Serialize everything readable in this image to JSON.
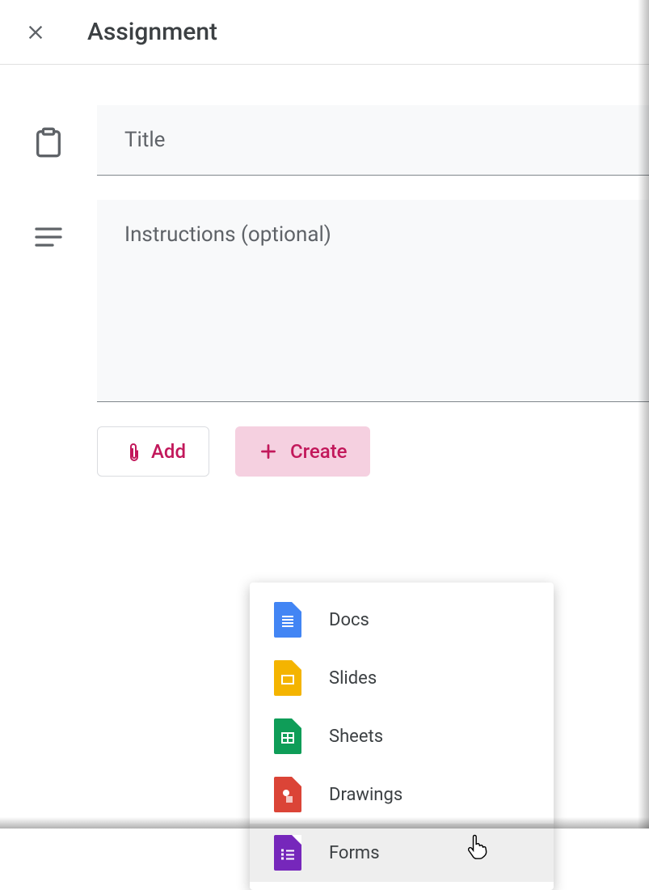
{
  "header": {
    "title": "Assignment"
  },
  "fields": {
    "title_placeholder": "Title",
    "instructions_placeholder": "Instructions (optional)"
  },
  "buttons": {
    "add_label": "Add",
    "create_label": "Create"
  },
  "create_menu": {
    "items": [
      {
        "label": "Docs",
        "icon": "docs"
      },
      {
        "label": "Slides",
        "icon": "slides"
      },
      {
        "label": "Sheets",
        "icon": "sheets"
      },
      {
        "label": "Drawings",
        "icon": "drawings"
      },
      {
        "label": "Forms",
        "icon": "forms"
      }
    ],
    "hover_index": 4
  },
  "colors": {
    "accent": "#c2185b",
    "create_bg": "#f5d0e0"
  }
}
